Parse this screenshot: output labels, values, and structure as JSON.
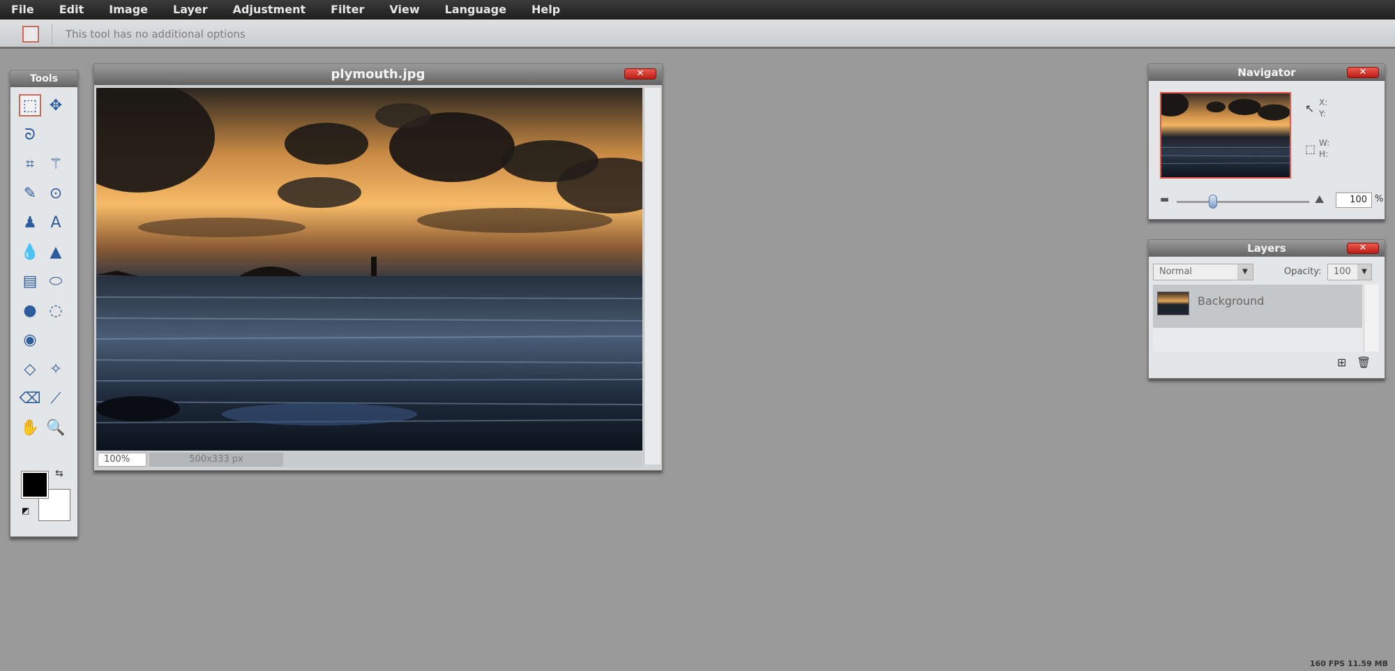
{
  "menu": [
    "File",
    "Edit",
    "Image",
    "Layer",
    "Adjustment",
    "Filter",
    "View",
    "Language",
    "Help"
  ],
  "options_bar": {
    "message": "This tool has no additional options"
  },
  "tools_panel": {
    "title": "Tools",
    "tools": [
      {
        "name": "marquee-tool-icon",
        "glyph": "⬚"
      },
      {
        "name": "move-tool-icon",
        "glyph": "✥"
      },
      {
        "name": "lasso-tool-icon",
        "glyph": "ᘐ"
      },
      {
        "name": "empty",
        "glyph": ""
      },
      {
        "name": "crop-tool-icon",
        "glyph": "⌗"
      },
      {
        "name": "wand-tool-icon",
        "glyph": "⚚"
      },
      {
        "name": "pencil-tool-icon",
        "glyph": "✎"
      },
      {
        "name": "brush-tool-icon",
        "glyph": "⊙"
      },
      {
        "name": "clone-stamp-tool-icon",
        "glyph": "♟"
      },
      {
        "name": "type-tool-icon",
        "glyph": "A"
      },
      {
        "name": "drop-tool-icon",
        "glyph": "💧"
      },
      {
        "name": "bucket-tool-icon",
        "glyph": "▲"
      },
      {
        "name": "gradient-tool-icon",
        "glyph": "▤"
      },
      {
        "name": "smudge-tool-icon",
        "glyph": "⬭"
      },
      {
        "name": "burn-tool-icon",
        "glyph": "●"
      },
      {
        "name": "dodge-tool-icon",
        "glyph": "◌"
      },
      {
        "name": "redeye-tool-icon",
        "glyph": "◉"
      },
      {
        "name": "empty",
        "glyph": ""
      },
      {
        "name": "spot-heal-tool-icon",
        "glyph": "◇"
      },
      {
        "name": "bloat-tool-icon",
        "glyph": "✧"
      },
      {
        "name": "eraser-tool-icon",
        "glyph": "⌫"
      },
      {
        "name": "eyedropper-tool-icon",
        "glyph": "⟋"
      },
      {
        "name": "hand-tool-icon",
        "glyph": "✋"
      },
      {
        "name": "zoom-tool-icon",
        "glyph": "🔍"
      }
    ],
    "foreground_color": "#000000",
    "background_color": "#ffffff"
  },
  "document": {
    "title": "plymouth.jpg",
    "zoom": "100%",
    "size": "500x333 px"
  },
  "navigator": {
    "title": "Navigator",
    "x_label": "X:",
    "y_label": "Y:",
    "w_label": "W:",
    "h_label": "H:",
    "zoom": "100",
    "zoom_unit": "%"
  },
  "layers": {
    "title": "Layers",
    "blend_mode": "Normal",
    "opacity_label": "Opacity:",
    "opacity": "100",
    "items": [
      {
        "name": "Background"
      }
    ]
  },
  "status": {
    "fps": "160 FPS 11.59 MB"
  },
  "close_label": "✕"
}
